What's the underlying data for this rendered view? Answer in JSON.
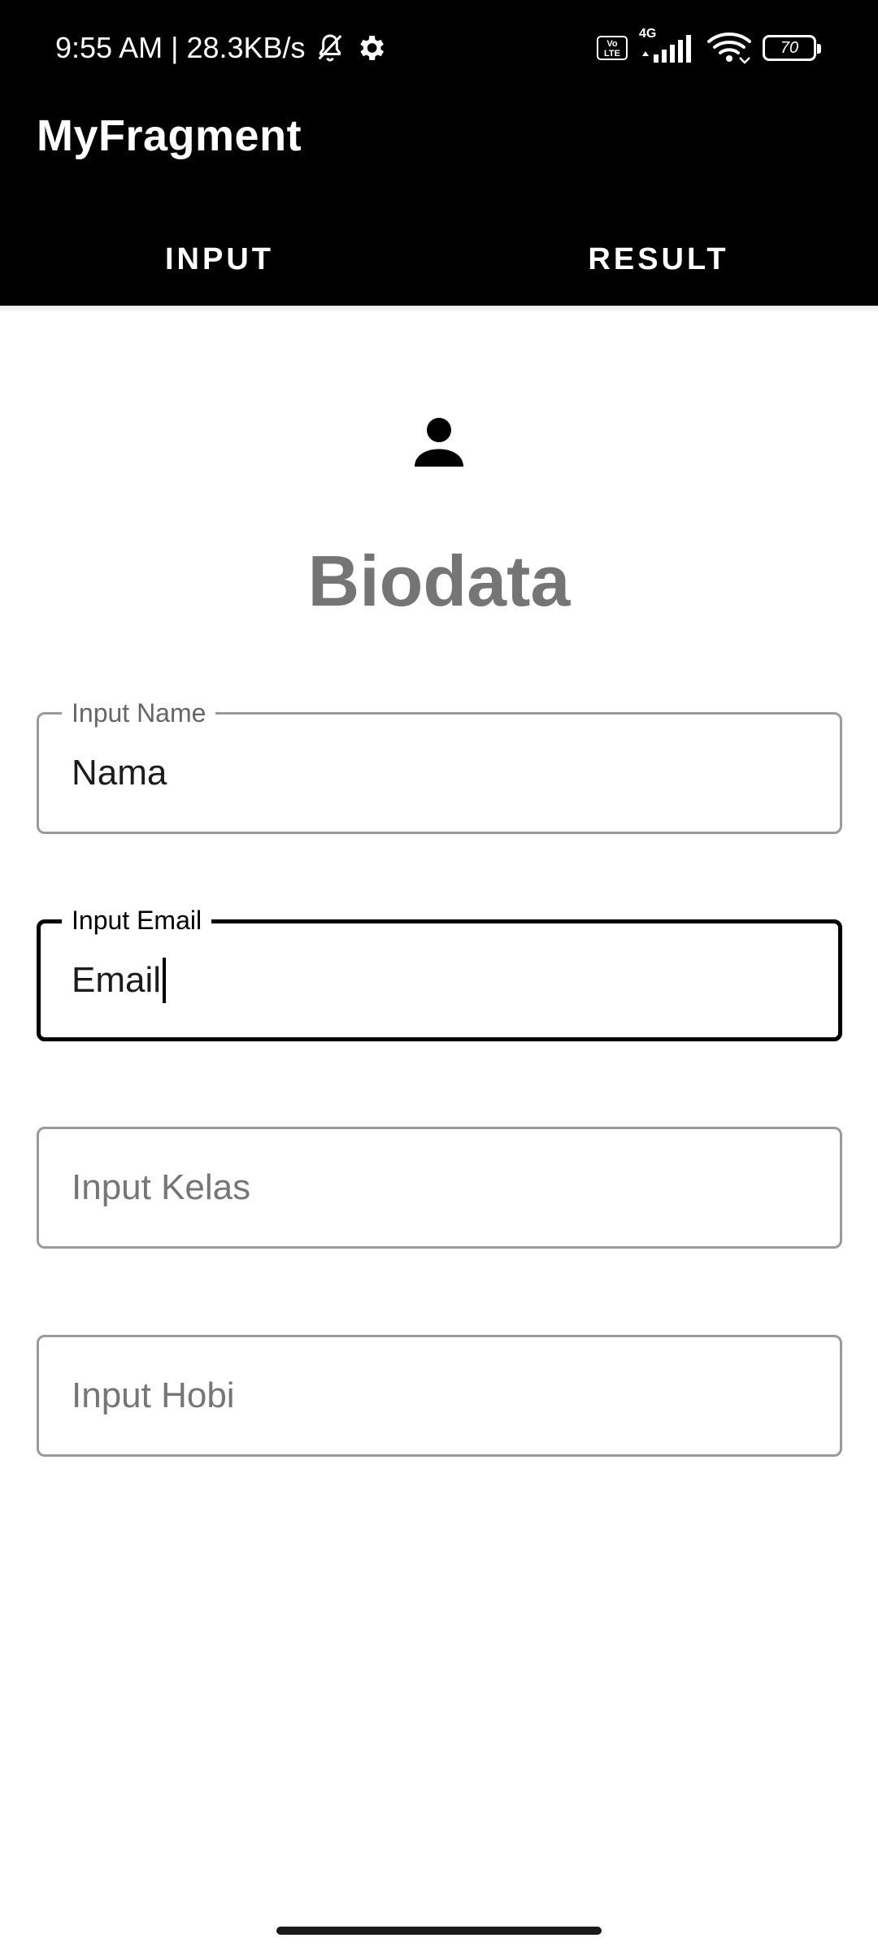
{
  "status_bar": {
    "time_speed": "9:55 AM | 28.3KB/s",
    "volte_badge": "Vo\nLTE",
    "network_type": "4G",
    "battery_level": "70",
    "icons": [
      "bell-off-icon",
      "settings-gear-icon",
      "volte-icon",
      "signal-icon",
      "wifi-icon",
      "battery-icon"
    ]
  },
  "app_bar": {
    "title": "MyFragment"
  },
  "tabs": [
    {
      "label": "INPUT",
      "selected": true
    },
    {
      "label": "RESULT",
      "selected": false
    }
  ],
  "main": {
    "icon": "person-icon",
    "title": "Biodata",
    "fields": {
      "name": {
        "label": "Input Name",
        "value": "Nama"
      },
      "email": {
        "label": "Input Email",
        "value": "Email",
        "focused": true
      },
      "kelas": {
        "placeholder": "Input Kelas",
        "value": ""
      },
      "hobi": {
        "placeholder": "Input Hobi",
        "value": ""
      }
    }
  },
  "colors": {
    "header_bg": "#000000",
    "title_gray": "#757575",
    "field_border": "#9a9a9a",
    "focused_border": "#000000"
  }
}
